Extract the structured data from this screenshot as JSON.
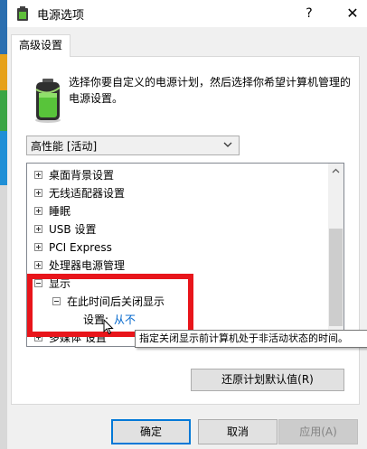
{
  "window": {
    "title": "电源选项",
    "help_glyph": "?",
    "close_glyph": "✕"
  },
  "tab": {
    "label": "高级设置"
  },
  "description": "选择你要自定义的电源计划，然后选择你希望计算机管理的电源设置。",
  "plan_select": {
    "value": "高性能 [活动]"
  },
  "tree": {
    "items": [
      {
        "label": "桌面背景设置",
        "expanded": false
      },
      {
        "label": "无线适配器设置",
        "expanded": false
      },
      {
        "label": "睡眠",
        "expanded": false
      },
      {
        "label": "USB 设置",
        "expanded": false
      },
      {
        "label": "PCI Express",
        "expanded": false
      },
      {
        "label": "处理器电源管理",
        "expanded": false
      },
      {
        "label": "显示",
        "expanded": true
      },
      {
        "label": "在此时间后关闭显示",
        "expanded": true
      },
      {
        "setting_label": "设置:",
        "setting_value": "从不"
      },
      {
        "label": "多媒体 设置",
        "expanded": false
      }
    ]
  },
  "tooltip": "指定关闭显示前计算机处于非活动状态的时间。",
  "buttons": {
    "restore": "还原计划默认值(R)",
    "ok": "确定",
    "cancel": "取消",
    "apply": "应用(A)"
  },
  "colors": {
    "highlight": "#e8151b",
    "link": "#0066cc",
    "focus": "#0078d7"
  }
}
